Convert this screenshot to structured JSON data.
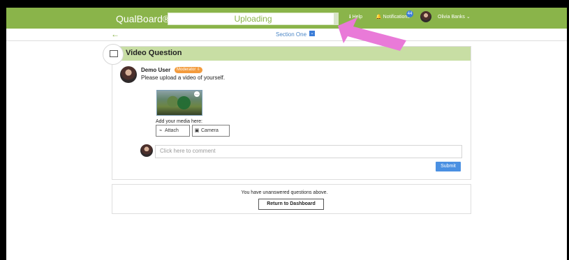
{
  "topbar": {
    "brand": "QualBoard®",
    "upload_label": "Uploading",
    "help": "Help",
    "notifications": "Notifications",
    "notification_count": "44",
    "user": "Olivia Banks ⌄"
  },
  "section": {
    "title": "Section One",
    "chevron": "⌄"
  },
  "question": {
    "title": "Video Question",
    "author": "Demo User",
    "role": "Moderator ⇩",
    "prompt": "Please upload a video of yourself.",
    "media_label": "Add your media here:",
    "attach": "Attach",
    "camera": "Camera",
    "comment_placeholder": "Click here to comment",
    "submit": "Submit"
  },
  "notice": {
    "text": "You have unanswered questions above.",
    "button": "Return to Dashboard"
  },
  "colors": {
    "green": "#8ab44a",
    "light_green": "#c8dea4",
    "blue": "#4a90e2",
    "orange": "#f39b3d",
    "pink": "#e97ad8"
  },
  "icons": {
    "help": "info-icon",
    "notifications": "bell-icon",
    "attach": "paperclip-icon",
    "camera": "camera-icon",
    "image": "image-icon"
  }
}
